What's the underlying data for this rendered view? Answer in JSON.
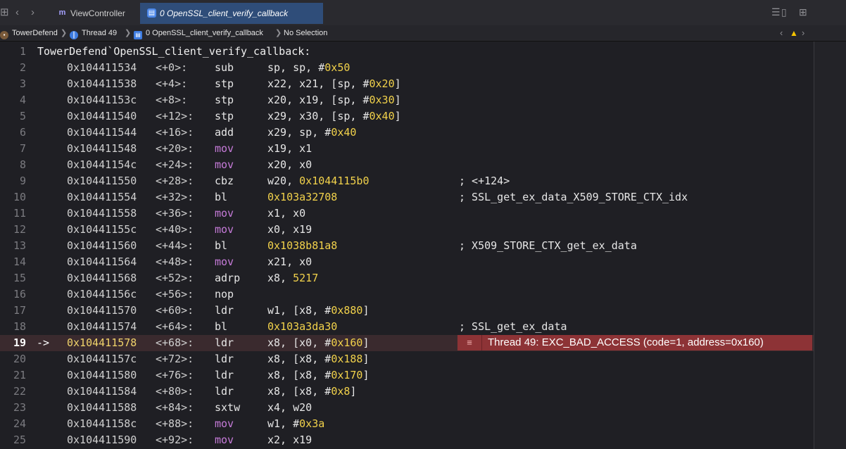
{
  "tabbar": {
    "tabs": [
      {
        "label": "ViewController",
        "icon": "swift-file-icon"
      },
      {
        "label": "0 OpenSSL_client_verify_callback",
        "icon": "disassembly-icon",
        "active": true
      }
    ]
  },
  "jumpbar": {
    "crumbs": [
      {
        "label": "TowerDefend",
        "icon": "app-icon"
      },
      {
        "label": "Thread 49",
        "icon": "thread-icon"
      },
      {
        "label": "0 OpenSSL_client_verify_callback",
        "icon": "frame-icon"
      },
      {
        "label": "No Selection"
      }
    ]
  },
  "code": {
    "header": "TowerDefend`OpenSSL_client_verify_callback:",
    "current_line": 19,
    "arrow": "->",
    "lines": [
      {
        "n": "1"
      },
      {
        "n": "2",
        "addr": "0x104411534",
        "off": "<+0>:",
        "mn": "sub",
        "ops": [
          {
            "t": "sp, sp, #"
          },
          {
            "t": "0x50",
            "num": true
          }
        ]
      },
      {
        "n": "3",
        "addr": "0x104411538",
        "off": "<+4>:",
        "mn": "stp",
        "ops": [
          {
            "t": "x22, x21, [sp, #"
          },
          {
            "t": "0x20",
            "num": true
          },
          {
            "t": "]"
          }
        ]
      },
      {
        "n": "4",
        "addr": "0x10441153c",
        "off": "<+8>:",
        "mn": "stp",
        "ops": [
          {
            "t": "x20, x19, [sp, #"
          },
          {
            "t": "0x30",
            "num": true
          },
          {
            "t": "]"
          }
        ]
      },
      {
        "n": "5",
        "addr": "0x104411540",
        "off": "<+12>:",
        "mn": "stp",
        "ops": [
          {
            "t": "x29, x30, [sp, #"
          },
          {
            "t": "0x40",
            "num": true
          },
          {
            "t": "]"
          }
        ]
      },
      {
        "n": "6",
        "addr": "0x104411544",
        "off": "<+16>:",
        "mn": "add",
        "ops": [
          {
            "t": "x29, sp, #"
          },
          {
            "t": "0x40",
            "num": true
          }
        ]
      },
      {
        "n": "7",
        "addr": "0x104411548",
        "off": "<+20>:",
        "mn": "mov",
        "purple": true,
        "ops": [
          {
            "t": "x19, x1"
          }
        ]
      },
      {
        "n": "8",
        "addr": "0x10441154c",
        "off": "<+24>:",
        "mn": "mov",
        "purple": true,
        "ops": [
          {
            "t": "x20, x0"
          }
        ]
      },
      {
        "n": "9",
        "addr": "0x104411550",
        "off": "<+28>:",
        "mn": "cbz",
        "ops": [
          {
            "t": "w20, "
          },
          {
            "t": "0x1044115b0",
            "num": true
          }
        ],
        "cmt": "; <+124>"
      },
      {
        "n": "10",
        "addr": "0x104411554",
        "off": "<+32>:",
        "mn": "bl",
        "ops": [
          {
            "t": "0x103a32708",
            "num": true
          }
        ],
        "cmt": "; SSL_get_ex_data_X509_STORE_CTX_idx"
      },
      {
        "n": "11",
        "addr": "0x104411558",
        "off": "<+36>:",
        "mn": "mov",
        "purple": true,
        "ops": [
          {
            "t": "x1, x0"
          }
        ]
      },
      {
        "n": "12",
        "addr": "0x10441155c",
        "off": "<+40>:",
        "mn": "mov",
        "purple": true,
        "ops": [
          {
            "t": "x0, x19"
          }
        ]
      },
      {
        "n": "13",
        "addr": "0x104411560",
        "off": "<+44>:",
        "mn": "bl",
        "ops": [
          {
            "t": "0x1038b81a8",
            "num": true
          }
        ],
        "cmt": "; X509_STORE_CTX_get_ex_data"
      },
      {
        "n": "14",
        "addr": "0x104411564",
        "off": "<+48>:",
        "mn": "mov",
        "purple": true,
        "ops": [
          {
            "t": "x21, x0"
          }
        ]
      },
      {
        "n": "15",
        "addr": "0x104411568",
        "off": "<+52>:",
        "mn": "adrp",
        "ops": [
          {
            "t": "x8, "
          },
          {
            "t": "5217",
            "num": true
          }
        ]
      },
      {
        "n": "16",
        "addr": "0x10441156c",
        "off": "<+56>:",
        "mn": "nop",
        "ops": []
      },
      {
        "n": "17",
        "addr": "0x104411570",
        "off": "<+60>:",
        "mn": "ldr",
        "ops": [
          {
            "t": "w1, [x8, #"
          },
          {
            "t": "0x880",
            "num": true
          },
          {
            "t": "]"
          }
        ]
      },
      {
        "n": "18",
        "addr": "0x104411574",
        "off": "<+64>:",
        "mn": "bl",
        "ops": [
          {
            "t": "0x103a3da30",
            "num": true
          }
        ],
        "cmt": "; SSL_get_ex_data"
      },
      {
        "n": "19",
        "addr": "0x104411578",
        "off": "<+68>:",
        "mn": "ldr",
        "ops": [
          {
            "t": "x8, [x0, #"
          },
          {
            "t": "0x160",
            "num": true
          },
          {
            "t": "]"
          }
        ],
        "error": "Thread 49: EXC_BAD_ACCESS (code=1, address=0x160)"
      },
      {
        "n": "20",
        "addr": "0x10441157c",
        "off": "<+72>:",
        "mn": "ldr",
        "ops": [
          {
            "t": "x8, [x8, #"
          },
          {
            "t": "0x188",
            "num": true
          },
          {
            "t": "]"
          }
        ]
      },
      {
        "n": "21",
        "addr": "0x104411580",
        "off": "<+76>:",
        "mn": "ldr",
        "ops": [
          {
            "t": "x8, [x8, #"
          },
          {
            "t": "0x170",
            "num": true
          },
          {
            "t": "]"
          }
        ]
      },
      {
        "n": "22",
        "addr": "0x104411584",
        "off": "<+80>:",
        "mn": "ldr",
        "ops": [
          {
            "t": "x8, [x8, #"
          },
          {
            "t": "0x8",
            "num": true
          },
          {
            "t": "]"
          }
        ]
      },
      {
        "n": "23",
        "addr": "0x104411588",
        "off": "<+84>:",
        "mn": "sxtw",
        "ops": [
          {
            "t": "x4, w20"
          }
        ]
      },
      {
        "n": "24",
        "addr": "0x10441158c",
        "off": "<+88>:",
        "mn": "mov",
        "purple": true,
        "ops": [
          {
            "t": "w1, #"
          },
          {
            "t": "0x3a",
            "num": true
          }
        ]
      },
      {
        "n": "25",
        "addr": "0x104411590",
        "off": "<+92>:",
        "mn": "mov",
        "purple": true,
        "ops": [
          {
            "t": "x2, x19"
          }
        ]
      }
    ]
  }
}
